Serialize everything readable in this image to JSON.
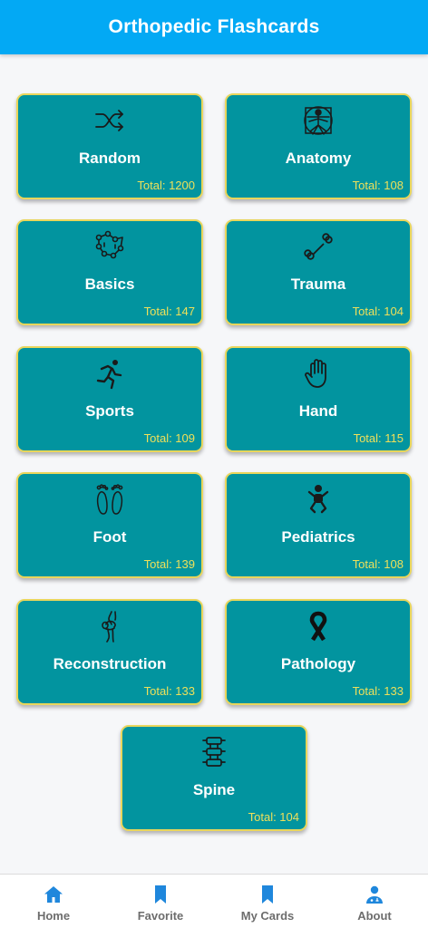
{
  "app": {
    "title": "Orthopedic Flashcards"
  },
  "theme": {
    "accent": "#03a9f4",
    "card_bg": "#02949f",
    "card_border": "#e9d65c",
    "total_text": "#eee05a"
  },
  "categories": [
    {
      "name": "Random",
      "total": "Total: 1200",
      "icon": "shuffle-icon"
    },
    {
      "name": "Anatomy",
      "total": "Total: 108",
      "icon": "vitruvian-man-icon"
    },
    {
      "name": "Basics",
      "total": "Total: 147",
      "icon": "atom-molecule-icon"
    },
    {
      "name": "Trauma",
      "total": "Total: 104",
      "icon": "bone-icon"
    },
    {
      "name": "Sports",
      "total": "Total: 109",
      "icon": "running-person-icon"
    },
    {
      "name": "Hand",
      "total": "Total: 115",
      "icon": "hand-icon"
    },
    {
      "name": "Foot",
      "total": "Total: 139",
      "icon": "footprints-icon"
    },
    {
      "name": "Pediatrics",
      "total": "Total: 108",
      "icon": "baby-icon"
    },
    {
      "name": "Reconstruction",
      "total": "Total: 133",
      "icon": "knee-joint-icon"
    },
    {
      "name": "Pathology",
      "total": "Total: 133",
      "icon": "awareness-ribbon-icon"
    },
    {
      "name": "Spine",
      "total": "Total: 104",
      "icon": "spine-icon"
    }
  ],
  "nav": [
    {
      "label": "Home",
      "icon": "home-icon",
      "active": true
    },
    {
      "label": "Favorite",
      "icon": "bookmark-icon"
    },
    {
      "label": "My Cards",
      "icon": "bookmark-icon"
    },
    {
      "label": "About",
      "icon": "doctor-icon"
    }
  ]
}
